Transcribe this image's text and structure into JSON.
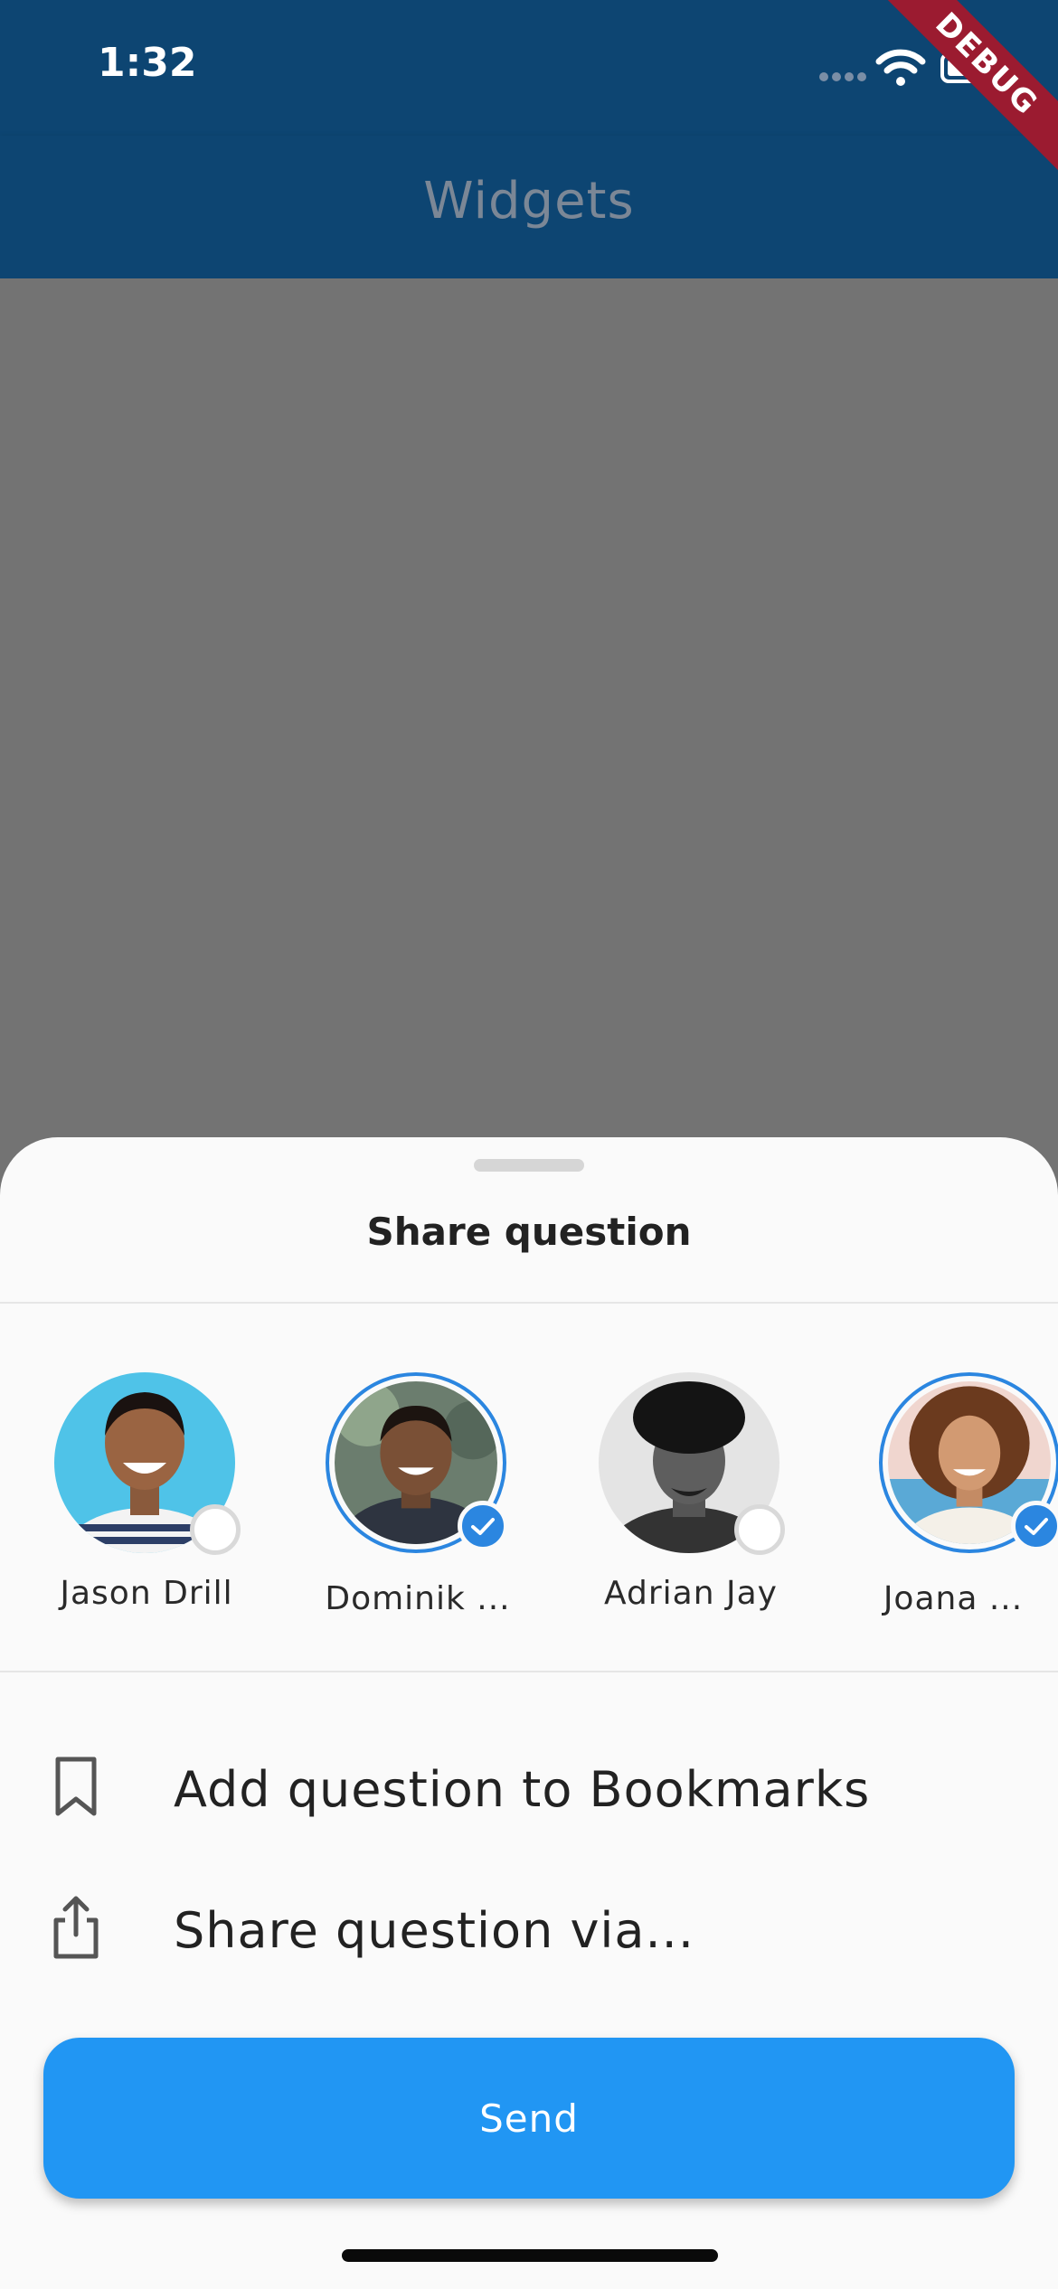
{
  "status_bar": {
    "time": "1:32"
  },
  "app_bar": {
    "title": "Widgets"
  },
  "debug_banner": {
    "label": "DEBUG"
  },
  "share_sheet": {
    "title": "Share question",
    "contacts": [
      {
        "name": "Jason Drill",
        "selected": false
      },
      {
        "name": "Dominik ...",
        "selected": true
      },
      {
        "name": "Adrian Jay",
        "selected": false
      },
      {
        "name": "Joana ...",
        "selected": true
      }
    ],
    "actions": [
      {
        "label": "Add question to Bookmarks",
        "icon": "bookmark-icon"
      },
      {
        "label": "Share question via...",
        "icon": "share-icon"
      }
    ],
    "send_label": "Send"
  },
  "colors": {
    "app_bar": "#0d4572",
    "accent": "#2196f3",
    "overlay": "#737373",
    "sheet": "#fafafa"
  }
}
